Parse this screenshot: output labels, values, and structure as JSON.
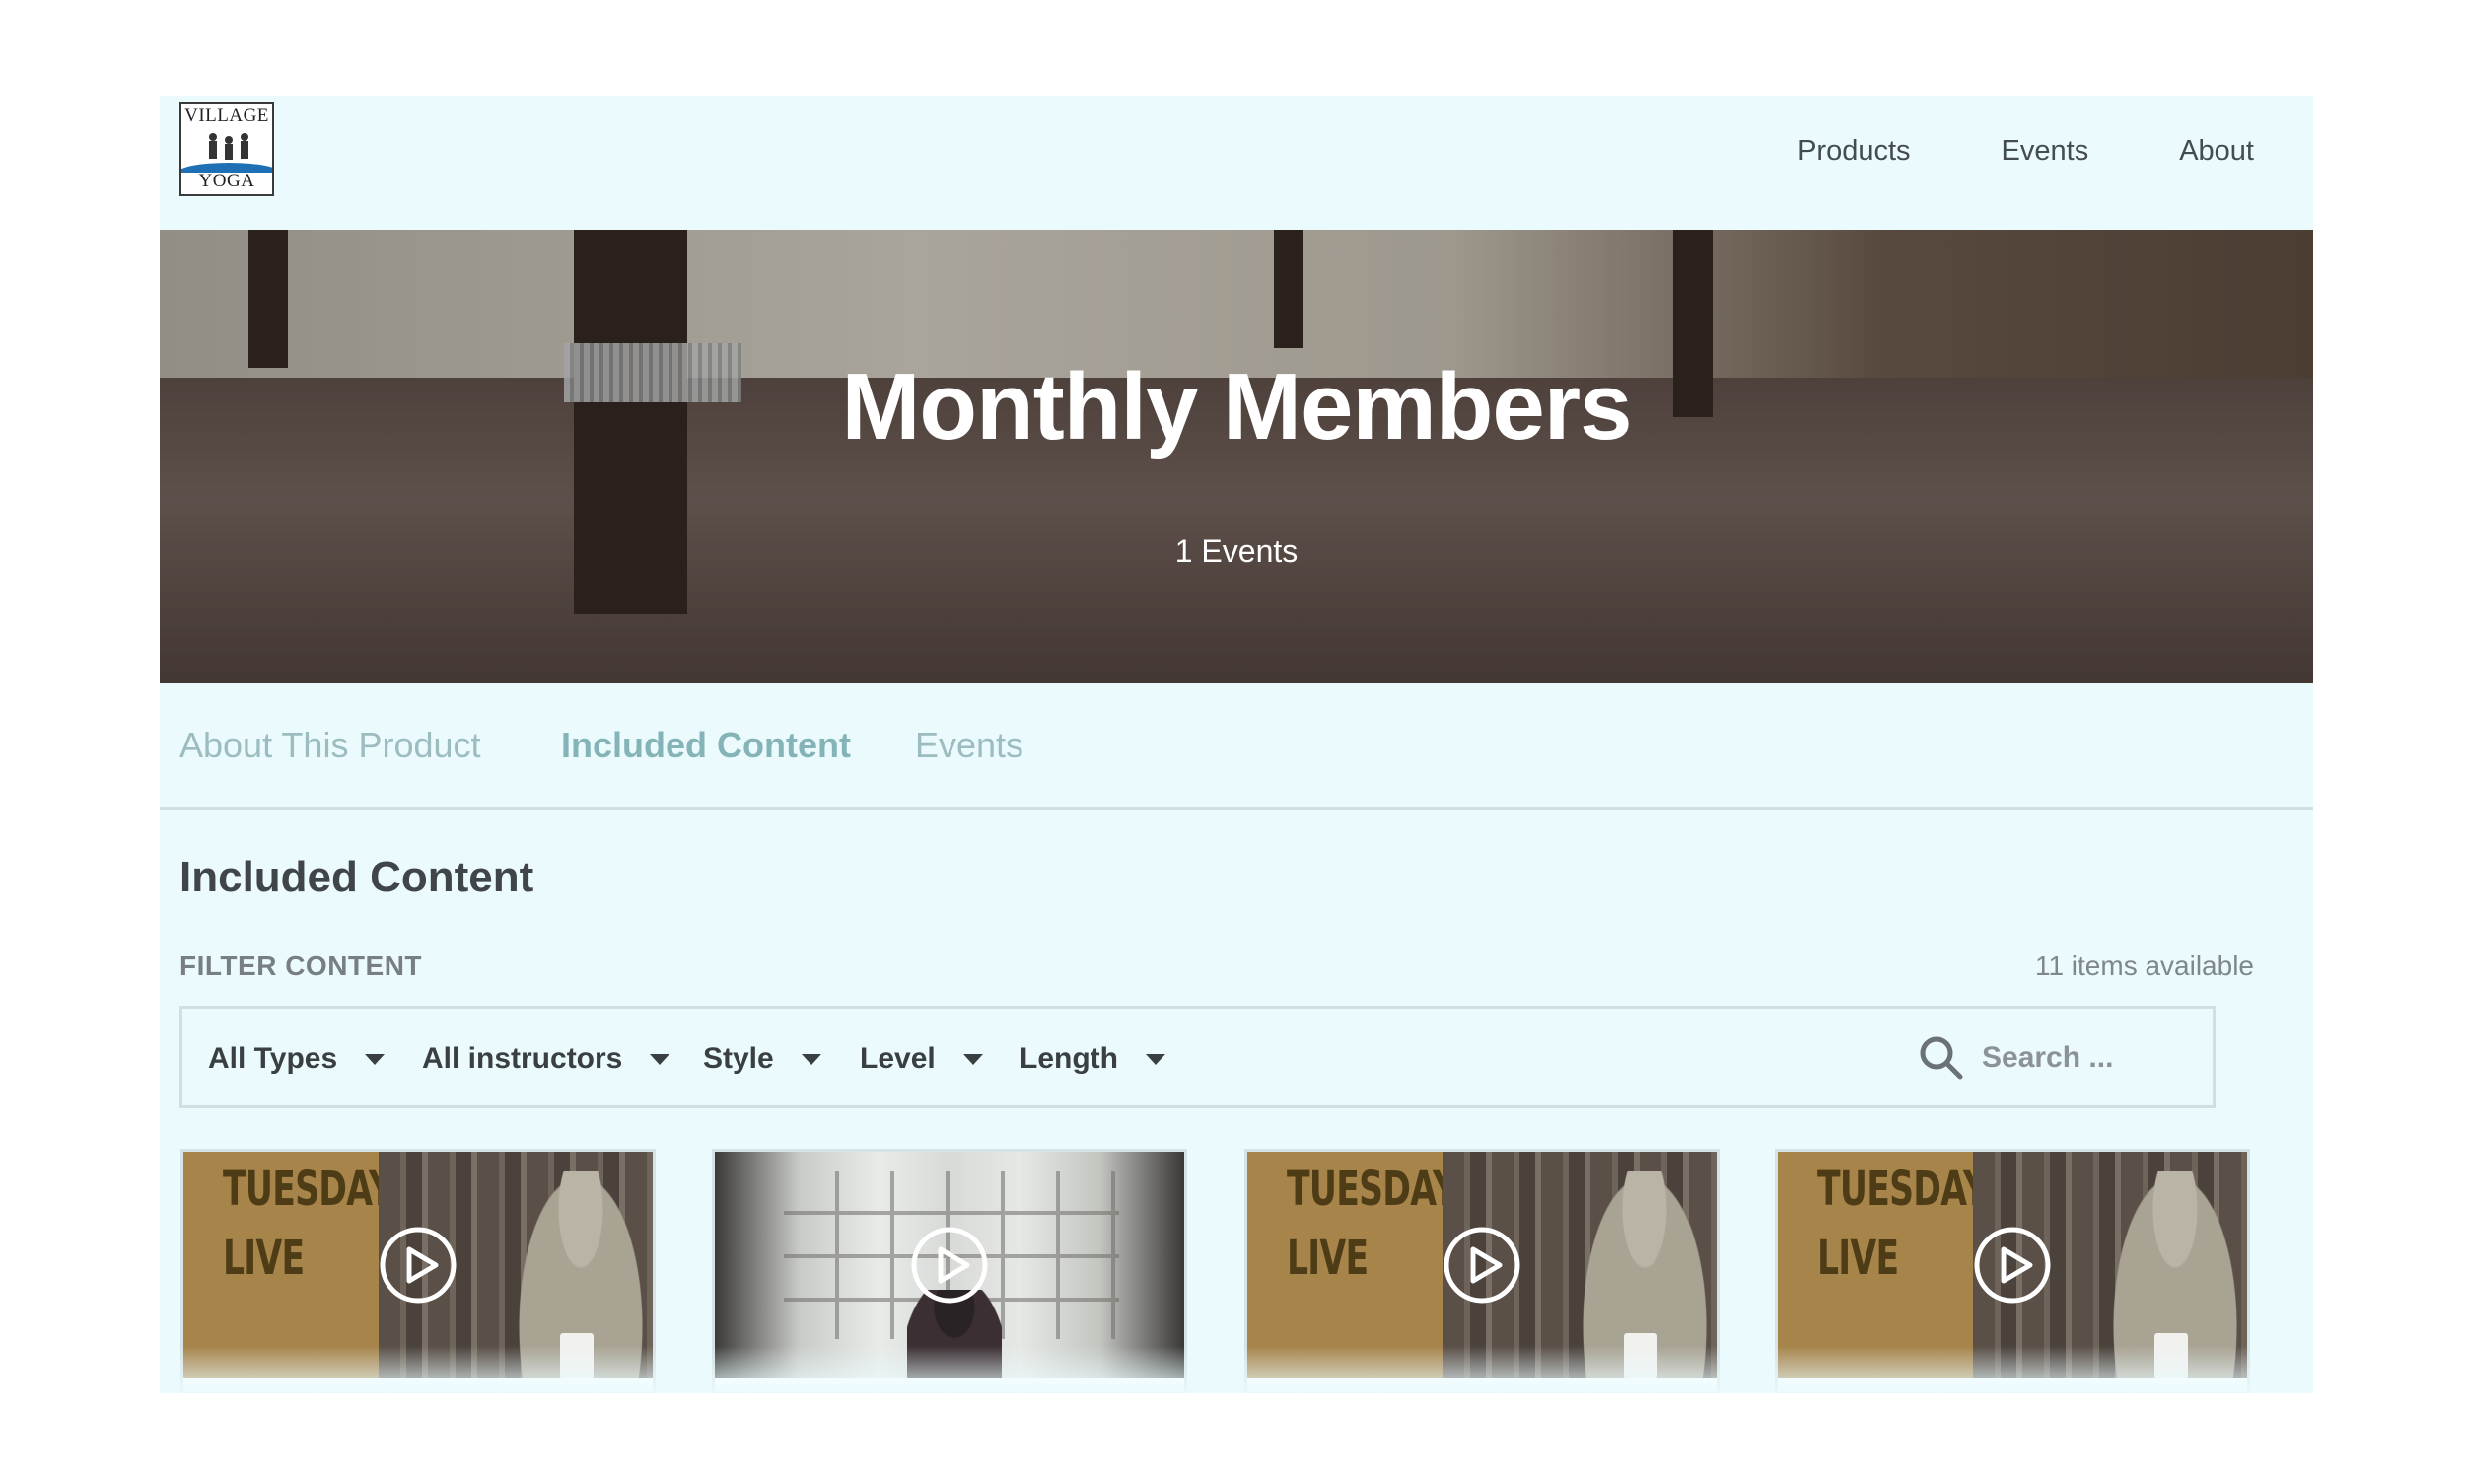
{
  "header": {
    "logo": {
      "top_text": "VILLAGE",
      "bottom_text": "YOGA"
    },
    "nav": [
      {
        "label": "Products"
      },
      {
        "label": "Events"
      },
      {
        "label": "About"
      }
    ]
  },
  "hero": {
    "title": "Monthly Members",
    "subtitle": "1 Events"
  },
  "tabs": [
    {
      "label": "About This Product",
      "active": false
    },
    {
      "label": "Included Content",
      "active": true
    },
    {
      "label": "Events",
      "active": false
    }
  ],
  "content": {
    "section_title": "Included Content",
    "filter_label": "FILTER CONTENT",
    "item_count": "11 items available",
    "filters": {
      "types": "All Types",
      "instructors": "All instructors",
      "style": "Style",
      "level": "Level",
      "length": "Length"
    },
    "search": {
      "placeholder": "Search ..."
    },
    "cards": [
      {
        "thumb_line1": "TUESDAY",
        "thumb_line2": "LIVE",
        "kind": "tuesday-live"
      },
      {
        "kind": "window-meditation"
      },
      {
        "thumb_line1": "TUESDAY",
        "thumb_line2": "LIVE",
        "kind": "tuesday-live"
      },
      {
        "thumb_line1": "TUESDAY",
        "thumb_line2": "LIVE",
        "kind": "tuesday-live"
      }
    ]
  },
  "colors": {
    "page_bg": "#eafafd",
    "tab_active": "#84b3b8",
    "tab_inactive": "#9cbcc0",
    "thumb_tan": "#a6844a",
    "logo_wave": "#1f6fb5"
  },
  "icons": [
    "search-icon",
    "play-icon",
    "caret-down-icon"
  ]
}
